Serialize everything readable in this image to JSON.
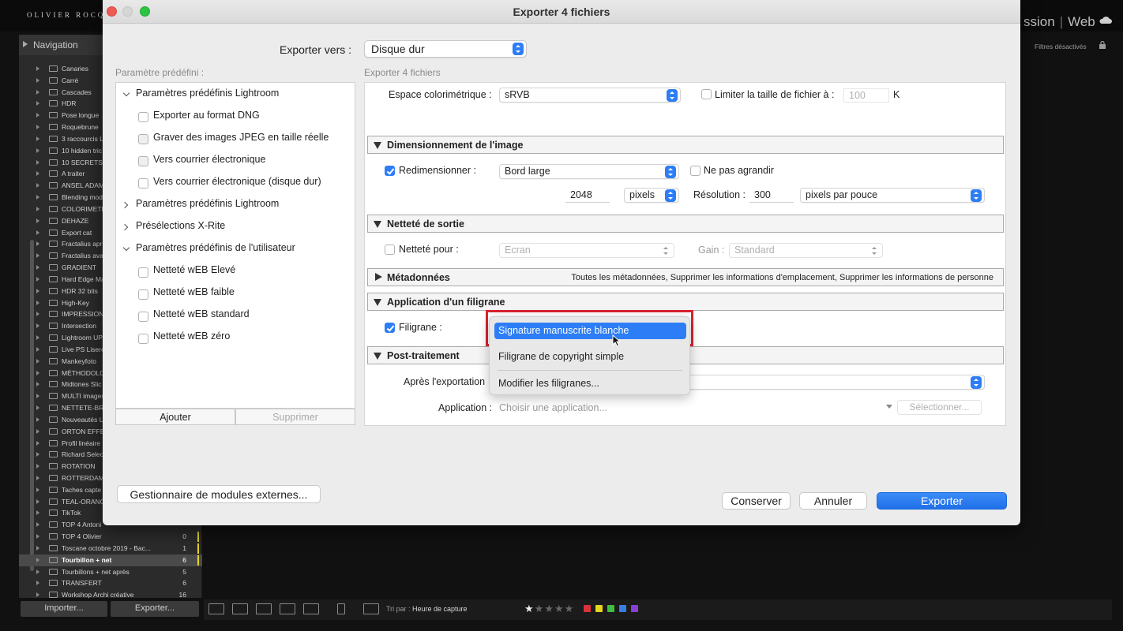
{
  "background": {
    "logo": "OLIVIER ROCQ",
    "modules": [
      "ssion",
      "Web"
    ],
    "navigator_label": "Navigation",
    "filters_label": "Filtres désactivés",
    "collections": [
      {
        "name": "Canaries",
        "count": ""
      },
      {
        "name": "Carré",
        "count": ""
      },
      {
        "name": "Cascades",
        "count": ""
      },
      {
        "name": "HDR",
        "count": ""
      },
      {
        "name": "Pose longue",
        "count": ""
      },
      {
        "name": "Roquebrune",
        "count": ""
      },
      {
        "name": "3 raccourcis L",
        "count": ""
      },
      {
        "name": "10 hidden tric",
        "count": ""
      },
      {
        "name": "10 SECRETS L",
        "count": ""
      },
      {
        "name": "A traiter",
        "count": ""
      },
      {
        "name": "ANSEL ADAM",
        "count": ""
      },
      {
        "name": "Blending mod",
        "count": ""
      },
      {
        "name": "COLORIMETR",
        "count": ""
      },
      {
        "name": "DEHAZE",
        "count": ""
      },
      {
        "name": "Export cat",
        "count": ""
      },
      {
        "name": "Fractalius apr",
        "count": ""
      },
      {
        "name": "Fractalius ava",
        "count": ""
      },
      {
        "name": "GRADIENT",
        "count": ""
      },
      {
        "name": "Hard Edge Ma",
        "count": ""
      },
      {
        "name": "HDR 32 bits",
        "count": ""
      },
      {
        "name": "High-Key",
        "count": ""
      },
      {
        "name": "IMPRESSION",
        "count": ""
      },
      {
        "name": "Intersection",
        "count": ""
      },
      {
        "name": "Lightroom UP",
        "count": ""
      },
      {
        "name": "Live PS Lisere",
        "count": ""
      },
      {
        "name": "Mankeyfoto",
        "count": ""
      },
      {
        "name": "MÉTHODOLO",
        "count": ""
      },
      {
        "name": "Midtones Slic",
        "count": ""
      },
      {
        "name": "MULTI images",
        "count": ""
      },
      {
        "name": "NETTETE-BRI",
        "count": ""
      },
      {
        "name": "Nouveautés L",
        "count": ""
      },
      {
        "name": "ORTON EFFE",
        "count": ""
      },
      {
        "name": "Profil linéaire",
        "count": ""
      },
      {
        "name": "Richard Select",
        "count": ""
      },
      {
        "name": "ROTATION",
        "count": ""
      },
      {
        "name": "ROTTERDAM",
        "count": ""
      },
      {
        "name": "Taches capte",
        "count": ""
      },
      {
        "name": "TEAL-ORANG",
        "count": ""
      },
      {
        "name": "TikTok",
        "count": ""
      },
      {
        "name": "TOP 4 Antoni",
        "count": ""
      },
      {
        "name": "TOP 4 Olivier",
        "count": "0"
      },
      {
        "name": "Toscane octobre 2019 - Bac...",
        "count": "1"
      },
      {
        "name": "Tourbillon + net",
        "count": "6"
      },
      {
        "name": "Tourbillons + net après",
        "count": "5"
      },
      {
        "name": "TRANSFERT",
        "count": "6"
      },
      {
        "name": "Workshop Archi créative",
        "count": "16"
      }
    ],
    "import_label": "Importer...",
    "export_label": "Exporter...",
    "sort_label": "Tri par :",
    "sort_value": "Heure de capture",
    "stars": "★★★★★",
    "colors": {
      "red": "#d8333a",
      "yellow": "#e6d41f",
      "green": "#3fbf3f",
      "blue": "#3a7de0",
      "purple": "#8a3fd0"
    }
  },
  "dialog": {
    "title": "Exporter 4 fichiers",
    "export_to_label": "Exporter vers :",
    "export_to_value": "Disque dur",
    "presets_label": "Paramètre prédéfini :",
    "presets": [
      {
        "label": "Paramètres prédéfinis Lightroom",
        "type": "group",
        "open": true
      },
      {
        "label": "Exporter au format DNG",
        "type": "item"
      },
      {
        "label": "Graver des images JPEG en taille réelle",
        "type": "item"
      },
      {
        "label": "Vers courrier électronique",
        "type": "item"
      },
      {
        "label": "Vers courrier électronique (disque dur)",
        "type": "item"
      },
      {
        "label": "Paramètres prédéfinis Lightroom",
        "type": "group",
        "open": false
      },
      {
        "label": "Présélections X-Rite",
        "type": "group",
        "open": false
      },
      {
        "label": "Paramètres prédéfinis de l'utilisateur",
        "type": "group",
        "open": true
      },
      {
        "label": "Netteté wEB Elevé",
        "type": "item"
      },
      {
        "label": "Netteté wEB faible",
        "type": "item"
      },
      {
        "label": "Netteté wEB standard",
        "type": "item"
      },
      {
        "label": "Netteté wEB zéro",
        "type": "item"
      }
    ],
    "add_label": "Ajouter",
    "remove_label": "Supprimer",
    "plugin_manager_label": "Gestionnaire de modules externes...",
    "export_files_label": "Exporter 4 fichiers",
    "colorspace": {
      "label": "Espace colorimétrique :",
      "value": "sRVB",
      "limit_label": "Limiter la taille de fichier à :",
      "limit_value": "100",
      "limit_unit": "K"
    },
    "sizing": {
      "title": "Dimensionnement de l'image",
      "resize_label": "Redimensionner :",
      "resize_value": "Bord large",
      "no_enlarge_label": "Ne pas agrandir",
      "size_value": "2048",
      "size_unit": "pixels",
      "resolution_label": "Résolution :",
      "resolution_value": "300",
      "resolution_unit": "pixels par pouce"
    },
    "sharpening": {
      "title": "Netteté de sortie",
      "sharpen_label": "Netteté pour :",
      "sharpen_value": "Ecran",
      "gain_label": "Gain :",
      "gain_value": "Standard"
    },
    "metadata": {
      "title": "Métadonnées",
      "summary": "Toutes les métadonnées, Supprimer les informations d'emplacement, Supprimer les informations de personne"
    },
    "watermark": {
      "title": "Application d'un filigrane",
      "label": "Filigrane :",
      "menu": [
        "Signature manuscrite blanche",
        "Filigrane de copyright simple",
        "Modifier les filigranes..."
      ]
    },
    "postprocess": {
      "title": "Post-traitement",
      "after_label": "Après l'exportation",
      "app_label": "Application :",
      "app_placeholder": "Choisir une application...",
      "choose_label": "Sélectionner..."
    },
    "buttons": {
      "keep": "Conserver",
      "cancel": "Annuler",
      "export": "Exporter"
    }
  }
}
